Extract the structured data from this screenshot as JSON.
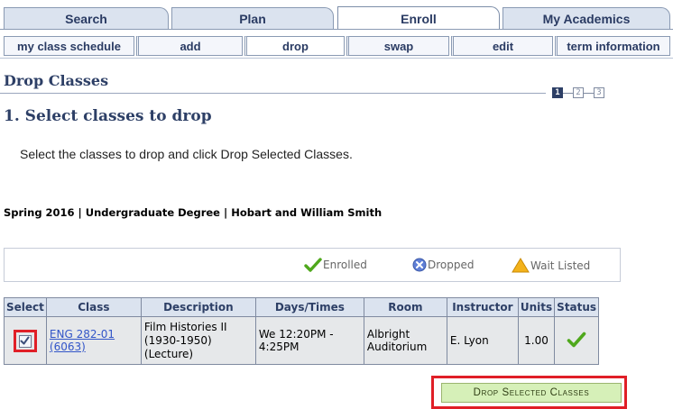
{
  "tabs": [
    {
      "label": "Search"
    },
    {
      "label": "Plan"
    },
    {
      "label": "Enroll",
      "active": true
    },
    {
      "label": "My Academics"
    }
  ],
  "subtabs": [
    {
      "label": "my class schedule"
    },
    {
      "label": "add"
    },
    {
      "label": "drop",
      "active": true
    },
    {
      "label": "swap"
    },
    {
      "label": "edit"
    },
    {
      "label": "term information"
    }
  ],
  "page": {
    "title": "Drop Classes",
    "steps": [
      "1",
      "2",
      "3"
    ],
    "current_step": 1,
    "step_heading": "1.  Select classes to drop",
    "instructions": "Select the classes to drop and click Drop Selected Classes.",
    "term": "Spring 2016 | Undergraduate Degree | Hobart and William Smith"
  },
  "legend": {
    "enrolled": "Enrolled",
    "dropped": "Dropped",
    "wait_listed": "Wait Listed"
  },
  "table": {
    "headers": [
      "Select",
      "Class",
      "Description",
      "Days/Times",
      "Room",
      "Instructor",
      "Units",
      "Status"
    ],
    "rows": [
      {
        "selected": true,
        "class_line1": "ENG 282-01",
        "class_line2": "(6063)",
        "description_line1": "Film Histories II",
        "description_line2": "(1930-1950)",
        "description_line3": "(Lecture)",
        "days_line1": "We 12:20PM -",
        "days_line2": "4:25PM",
        "room_line1": "Albright",
        "room_line2": "Auditorium",
        "instructor": "E. Lyon",
        "units": "1.00",
        "status": "Enrolled"
      }
    ]
  },
  "actions": {
    "drop_button": "Drop Selected Classes"
  },
  "colors": {
    "accent_navy": "#2d3f66",
    "tab_bg": "#dbe3ef",
    "highlight_red": "#e01f27",
    "button_green": "#d6f0b8",
    "link_blue": "#3255c8"
  }
}
